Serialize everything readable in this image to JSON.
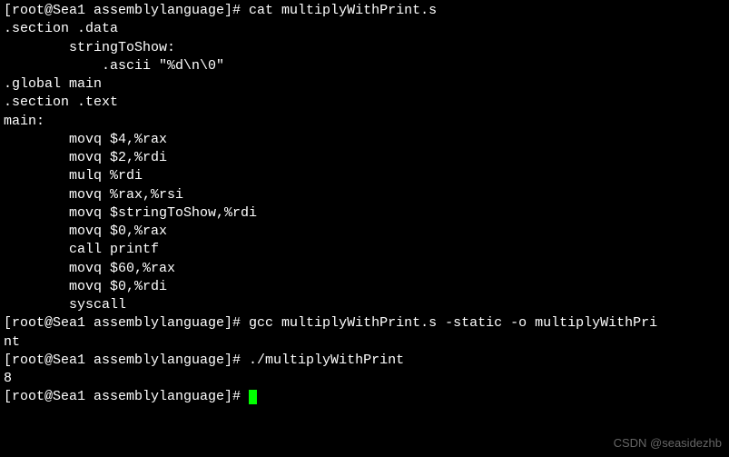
{
  "prompt1": "[root@Sea1 assemblylanguage]# ",
  "cmd1": "cat multiplyWithPrint.s",
  "cat_output": [
    ".section .data",
    "        stringToShow:",
    "            .ascii \"%d\\n\\0\"",
    ".global main",
    ".section .text",
    "main:",
    "        movq $4,%rax",
    "        movq $2,%rdi",
    "        mulq %rdi",
    "",
    "",
    "        movq %rax,%rsi",
    "        movq $stringToShow,%rdi",
    "        movq $0,%rax",
    "        call printf",
    "",
    "        movq $60,%rax",
    "        movq $0,%rdi",
    "        syscall"
  ],
  "prompt2": "[root@Sea1 assemblylanguage]# ",
  "cmd2_part1": "gcc multiplyWithPrint.s -static -o multiplyWithPri",
  "cmd2_part2": "nt",
  "prompt3": "[root@Sea1 assemblylanguage]# ",
  "cmd3": "./multiplyWithPrint",
  "run_output": "8",
  "prompt4": "[root@Sea1 assemblylanguage]# ",
  "watermark": "CSDN @seasidezhb"
}
